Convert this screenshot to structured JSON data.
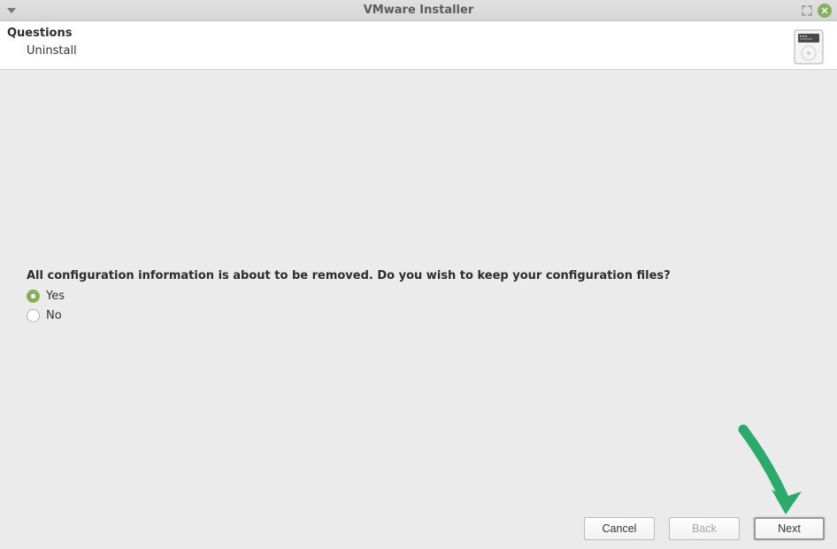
{
  "titlebar": {
    "title": "VMware Installer"
  },
  "header": {
    "title": "Questions",
    "subtitle": "Uninstall"
  },
  "question": {
    "prompt": "All configuration information is about to be removed. Do you wish to keep your configuration files?",
    "options": [
      {
        "label": "Yes",
        "selected": true
      },
      {
        "label": "No",
        "selected": false
      }
    ]
  },
  "buttons": {
    "cancel": "Cancel",
    "back": "Back",
    "next": "Next"
  }
}
